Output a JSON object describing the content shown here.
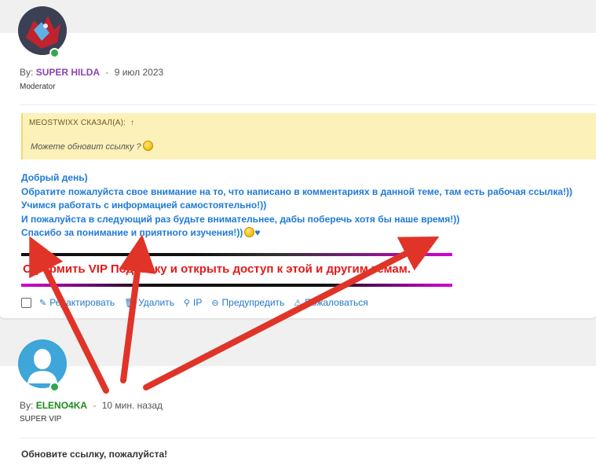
{
  "post1": {
    "by_label": "By:",
    "username": "SUPER HILDA",
    "separator": "-",
    "date": "9 июл 2023",
    "role": "Moderator",
    "quote": {
      "author_line": "MEOSTWIXX СКАЗАЛ(А):",
      "arrow": "↑",
      "text": "Можете обновит ссылку ?"
    },
    "message_lines": [
      "Добрый день)",
      "Обратите пожалуйста свое внимание на то, что написано в комментариях в данной теме, там есть рабочая ссылка!))",
      "Учимся работать с информацией самостоятельно!))",
      "И пожалуйста в следующий раз будьте внимательнее, дабы поберечь хотя бы наше время!))",
      "Спасибо за понимание и приятного изучения!))"
    ],
    "heart": "♥",
    "vip_banner": "Оформить VIP Подписку и открыть доступ к этой и другим темам.",
    "actions": {
      "edit": "Редактировать",
      "delete": "Удалить",
      "ip": "IP",
      "warn": "Предупредить",
      "report": "Пожаловаться"
    }
  },
  "post2": {
    "by_label": "By:",
    "username": "ELENO4KA",
    "separator": "-",
    "date": "10 мин. назад",
    "role": "SUPER VIP",
    "message": "Обновите ссылку, пожалуйста!"
  },
  "colors": {
    "moderator_name": "#8e44ad",
    "vip_name": "#1f8a1f",
    "message_text": "#1e7ad6",
    "banner_text": "#e21a1a",
    "annotation_arrows": "#e03428"
  }
}
